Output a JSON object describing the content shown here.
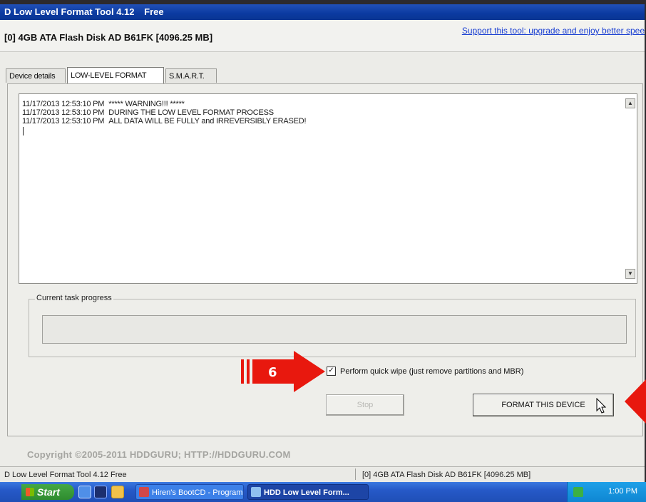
{
  "window": {
    "title": "D Low Level Format Tool 4.12",
    "edition": "Free"
  },
  "device_bar": {
    "device": "[0]  4GB ATA Flash Disk    AD B61FK    [4096.25 MB]",
    "support_link": "Support this tool: upgrade and enjoy better spee"
  },
  "tabs": [
    {
      "label": "Device details",
      "active": false
    },
    {
      "label": "LOW-LEVEL FORMAT",
      "active": true
    },
    {
      "label": "S.M.A.R.T.",
      "active": false
    }
  ],
  "log": [
    {
      "time": "11/17/2013 12:53:10 PM",
      "text": "***** WARNING!!! *****"
    },
    {
      "time": "11/17/2013 12:53:10 PM",
      "text": "DURING THE LOW LEVEL FORMAT PROCESS"
    },
    {
      "time": "11/17/2013 12:53:10 PM",
      "text": "ALL DATA WILL BE FULLY and IRREVERSIBLY ERASED!"
    }
  ],
  "progress": {
    "legend": "Current task progress",
    "value": 0
  },
  "options": {
    "quick_wipe_label": "Perform quick wipe (just remove partitions and MBR)",
    "quick_wipe_checked": true
  },
  "buttons": {
    "stop": "Stop",
    "format": "FORMAT THIS DEVICE"
  },
  "copyright": "Copyright ©2005-2011 HDDGURU;  HTTP://HDDGURU.COM",
  "statusbar": {
    "left": "D Low Level Format Tool 4.12   Free",
    "right": "[0]  4GB ATA Flash Disk    AD B61FK    [4096.25 MB]"
  },
  "taskbar": {
    "start": "Start",
    "tasks": [
      {
        "label": "Hiren's BootCD - Program..."
      },
      {
        "label": "HDD Low Level Form..."
      }
    ],
    "clock": "1:00 PM"
  },
  "annotations": {
    "step_number": "6"
  },
  "colors": {
    "titlebar": "#0b3aa0",
    "link": "#1a3fd2",
    "arrow": "#e8180e"
  }
}
